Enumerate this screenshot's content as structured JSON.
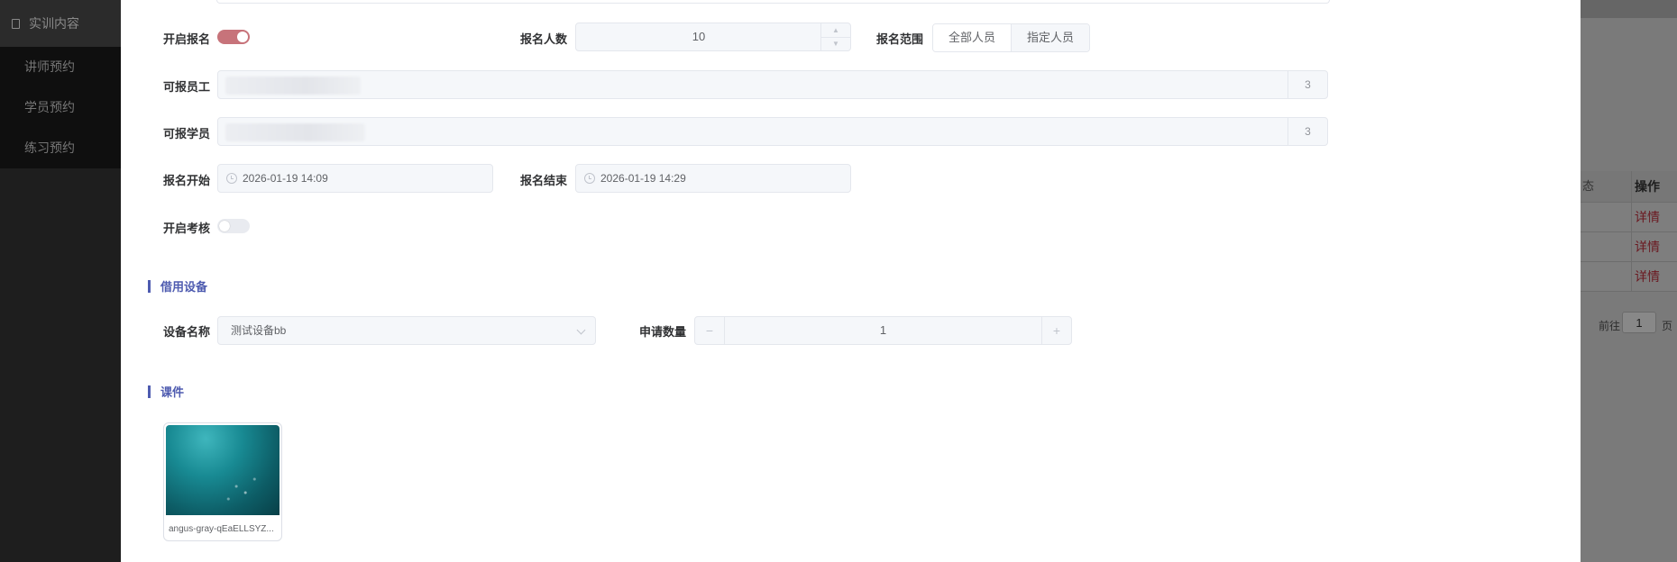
{
  "sidebar": {
    "header_label": "实训内容",
    "header_icon": "training-icon",
    "items": [
      {
        "label": "讲师预约"
      },
      {
        "label": "学员预约"
      },
      {
        "label": "练习预约"
      }
    ]
  },
  "background_page": {
    "table": {
      "col_partial_header": "态",
      "action_header": "操作",
      "rows": [
        {
          "action": "详情"
        },
        {
          "action": "详情"
        },
        {
          "action": "详情"
        }
      ]
    },
    "pager": {
      "goto_label": "前往",
      "page": "1",
      "page_suffix": "页"
    }
  },
  "form": {
    "enable_signup": {
      "label": "开启报名",
      "on": true
    },
    "signup_count": {
      "label": "报名人数",
      "value": "10"
    },
    "signup_scope": {
      "label": "报名范围",
      "options": [
        "全部人员",
        "指定人员"
      ],
      "selected": "指定人员"
    },
    "allowed_employees": {
      "label": "可报员工",
      "count": "3"
    },
    "allowed_students": {
      "label": "可报学员",
      "count": "3"
    },
    "signup_start": {
      "label": "报名开始",
      "value": "2026-01-19 14:09"
    },
    "signup_end": {
      "label": "报名结束",
      "value": "2026-01-19 14:29"
    },
    "enable_assessment": {
      "label": "开启考核",
      "on": false
    }
  },
  "equipment_section": {
    "title": "借用设备",
    "device_name": {
      "label": "设备名称",
      "value": "测试设备bb"
    },
    "quantity": {
      "label": "申请数量",
      "value": "1"
    }
  },
  "courseware_section": {
    "title": "课件",
    "files": [
      {
        "name": "angus-gray-qEaELLSYZ..."
      }
    ]
  },
  "colors": {
    "accent": "#4e5bb0",
    "switch_on": "#c7737a",
    "link": "#6b1820"
  }
}
